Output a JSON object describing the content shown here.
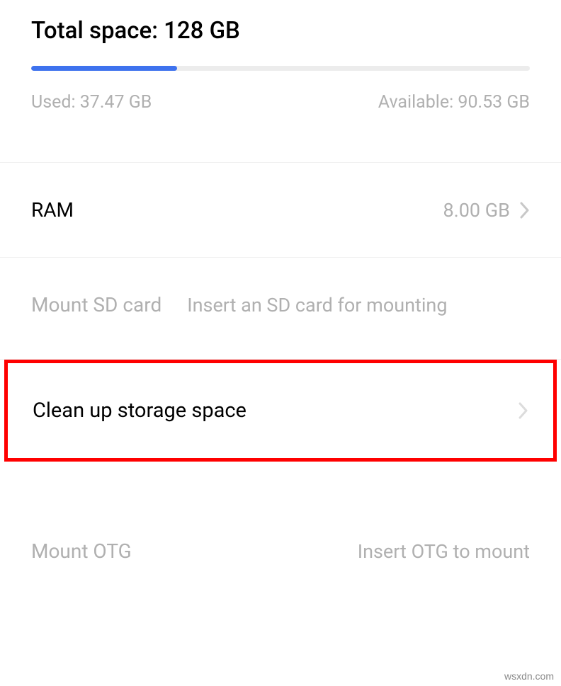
{
  "storage": {
    "title_prefix": "Total space: ",
    "total": "128 GB",
    "used_label": "Used: 37.47 GB",
    "available_label": "Available: 90.53 GB",
    "used_percent": 29.3
  },
  "ram": {
    "label": "RAM",
    "value": "8.00 GB"
  },
  "sd_card": {
    "label": "Mount SD card",
    "description": "Insert an SD card for mounting"
  },
  "cleanup": {
    "label": "Clean up storage space"
  },
  "otg": {
    "label": "Mount OTG",
    "description": "Insert OTG to mount"
  },
  "watermark": "wsxdn.com"
}
